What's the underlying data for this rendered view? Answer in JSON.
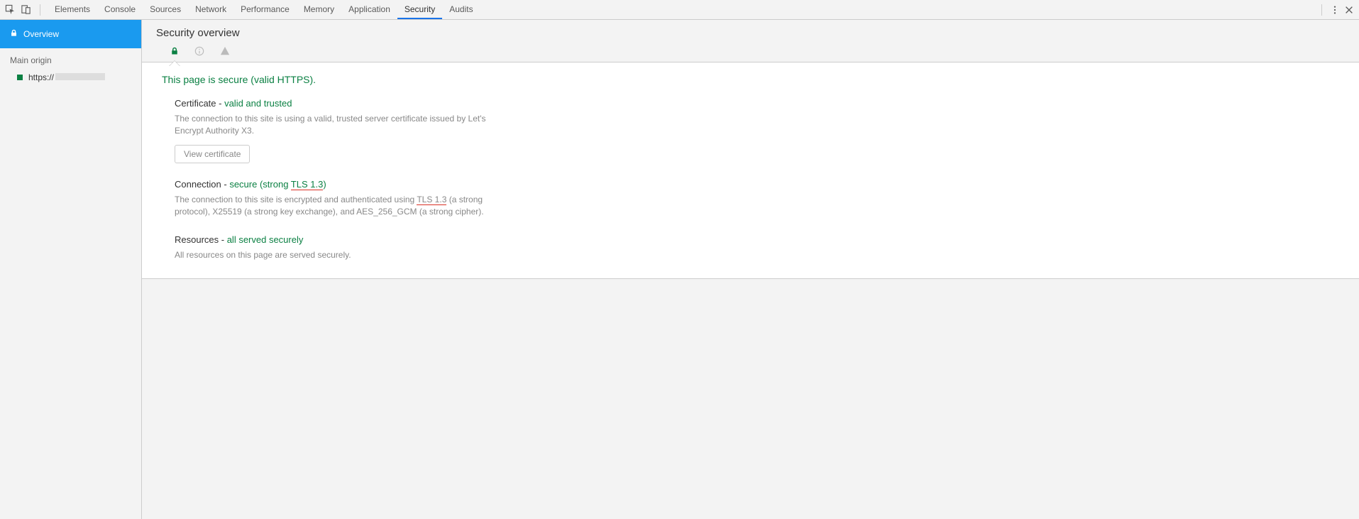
{
  "toolbar": {
    "tabs": [
      "Elements",
      "Console",
      "Sources",
      "Network",
      "Performance",
      "Memory",
      "Application",
      "Security",
      "Audits"
    ],
    "active_tab": "Security"
  },
  "sidebar": {
    "overview_label": "Overview",
    "section_label": "Main origin",
    "origin_prefix": "https://"
  },
  "content": {
    "title": "Security overview",
    "headline": "This page is secure (valid HTTPS).",
    "certificate": {
      "prefix": "Certificate - ",
      "status": "valid and trusted",
      "desc": "The connection to this site is using a valid, trusted server certificate issued by Let's Encrypt Authority X3.",
      "button": "View certificate"
    },
    "connection": {
      "prefix": "Connection - ",
      "status_pre": "secure (strong ",
      "tls": "TLS 1.3",
      "status_post": ")",
      "desc_pre": "The connection to this site is encrypted and authenticated using ",
      "desc_tls": "TLS 1.3",
      "desc_post": " (a strong protocol), X25519 (a strong key exchange), and AES_256_GCM (a strong cipher)."
    },
    "resources": {
      "prefix": "Resources - ",
      "status": "all served securely",
      "desc": "All resources on this page are served securely."
    }
  }
}
